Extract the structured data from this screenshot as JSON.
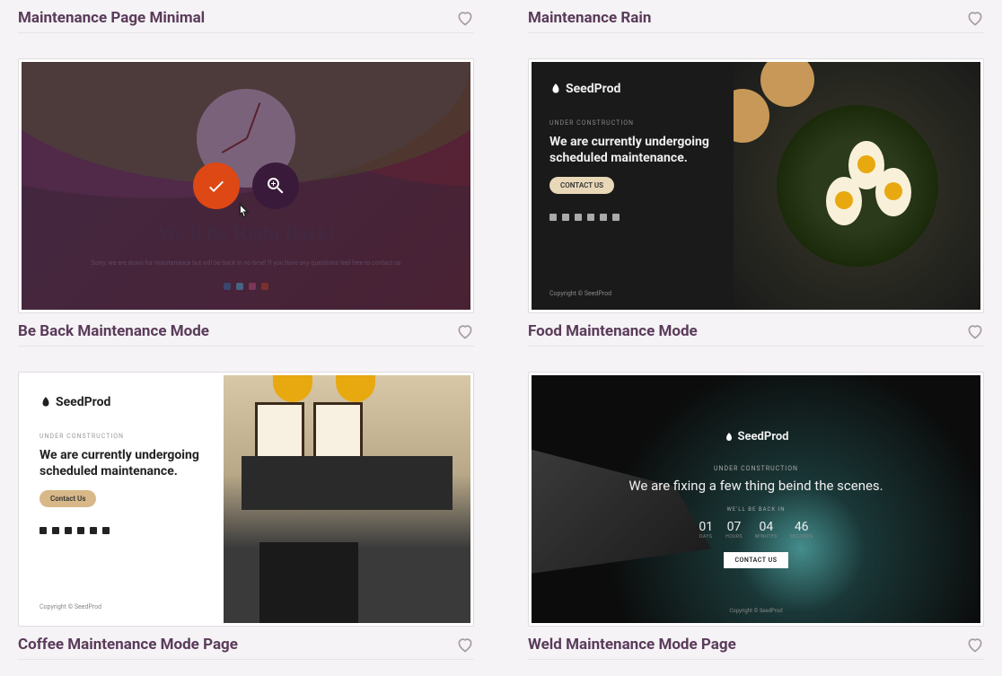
{
  "templates": [
    {
      "title": "Maintenance Page Minimal"
    },
    {
      "title": "Maintenance Rain"
    },
    {
      "title": "Be Back Maintenance Mode"
    },
    {
      "title": "Food Maintenance Mode"
    },
    {
      "title": "Coffee Maintenance Mode Page"
    },
    {
      "title": "Weld Maintenance Mode Page"
    }
  ],
  "beBack": {
    "heading": "We'll Be Right Back!",
    "sub": "Sorry, we are down for maintenance but will be back in no time! If you have any questions feel free to contact us"
  },
  "food": {
    "brand": "SeedProd",
    "tag": "UNDER CONSTRUCTION",
    "heading": "We are currently undergoing scheduled maintenance.",
    "cta": "CONTACT US",
    "copyright": "Copyright © SeedProd"
  },
  "coffee": {
    "brand": "SeedProd",
    "tag": "UNDER CONSTRUCTION",
    "heading": "We are currently undergoing scheduled maintenance.",
    "cta": "Contact Us",
    "copyright": "Copyright © SeedProd"
  },
  "weld": {
    "brand": "SeedProd",
    "tag": "UNDER CONSTRUCTION",
    "heading": "We are fixing a few thing beind the scenes.",
    "backLabel": "WE'LL BE BACK IN",
    "countdown": [
      {
        "num": "01",
        "lbl": "DAYS"
      },
      {
        "num": "07",
        "lbl": "HOURS"
      },
      {
        "num": "04",
        "lbl": "MINUTES"
      },
      {
        "num": "46",
        "lbl": "SECONDS"
      }
    ],
    "cta": "CONTACT US",
    "copyright": "Copyright © SeedProd"
  }
}
